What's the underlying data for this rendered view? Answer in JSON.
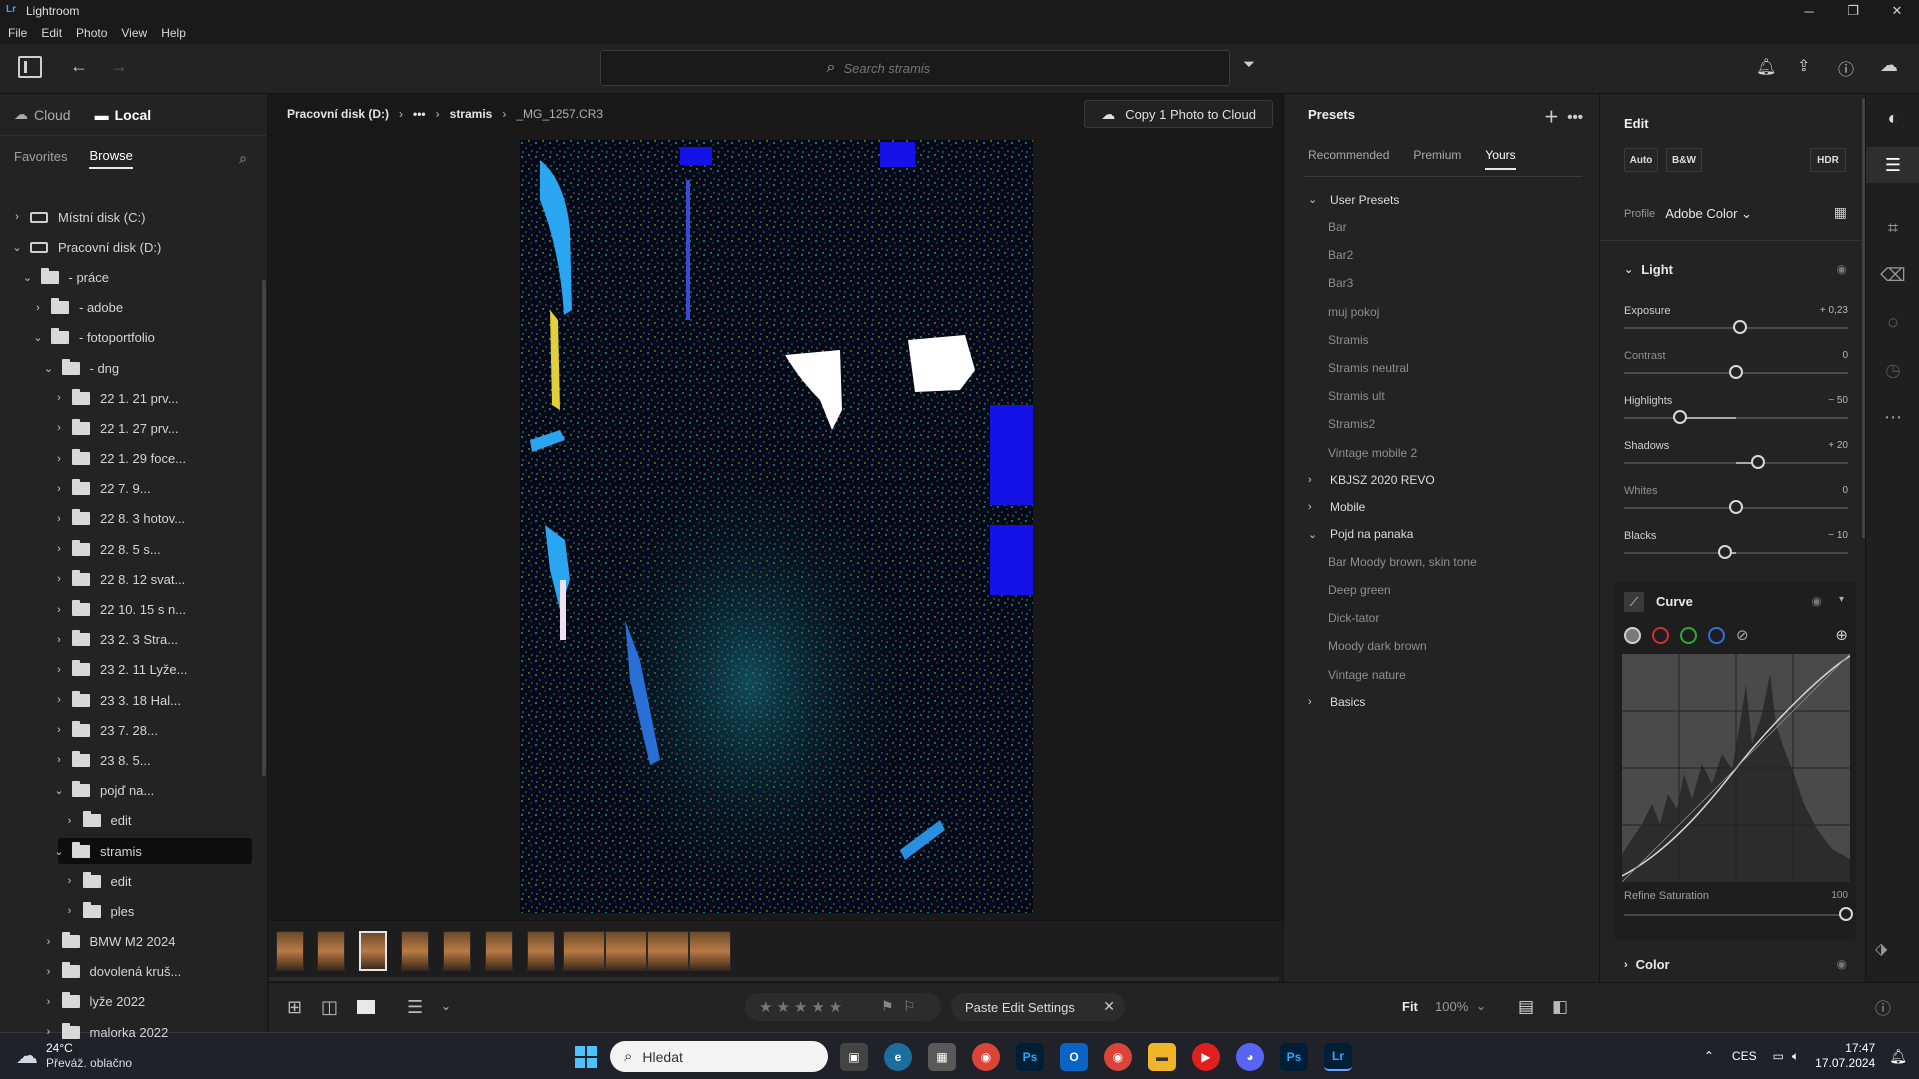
{
  "window": {
    "title": "Lightroom",
    "logo": "Lr"
  },
  "menu": [
    "File",
    "Edit",
    "Photo",
    "View",
    "Help"
  ],
  "search": {
    "placeholder": "Search stramis"
  },
  "source_tabs": {
    "cloud": "Cloud",
    "local": "Local"
  },
  "browse_tabs": {
    "favorites": "Favorites",
    "browse": "Browse"
  },
  "tree": [
    {
      "label": "Místní disk (C:)",
      "depth": 0,
      "type": "drive",
      "chev": "right"
    },
    {
      "label": "Pracovní disk (D:)",
      "depth": 0,
      "type": "drive",
      "chev": "down"
    },
    {
      "label": "- práce",
      "depth": 1,
      "type": "folder",
      "chev": "down"
    },
    {
      "label": "- adobe",
      "depth": 2,
      "type": "folder",
      "chev": "right"
    },
    {
      "label": "- fotoportfolio",
      "depth": 2,
      "type": "folder",
      "chev": "down"
    },
    {
      "label": "- dng",
      "depth": 3,
      "type": "folder",
      "chev": "down"
    },
    {
      "label": "22 1. 21 prv...",
      "depth": 4,
      "type": "folder",
      "chev": "right"
    },
    {
      "label": "22 1. 27 prv...",
      "depth": 4,
      "type": "folder",
      "chev": "right"
    },
    {
      "label": "22 1. 29 foce...",
      "depth": 4,
      "type": "folder",
      "chev": "right"
    },
    {
      "label": "22 7. 9...",
      "depth": 4,
      "type": "folder",
      "chev": "right"
    },
    {
      "label": "22 8. 3 hotov...",
      "depth": 4,
      "type": "folder",
      "chev": "right"
    },
    {
      "label": "22 8. 5 s...",
      "depth": 4,
      "type": "folder",
      "chev": "right"
    },
    {
      "label": "22 8. 12 svat...",
      "depth": 4,
      "type": "folder",
      "chev": "right"
    },
    {
      "label": "22 10. 15 s n...",
      "depth": 4,
      "type": "folder",
      "chev": "right"
    },
    {
      "label": "23 2. 3 Stra...",
      "depth": 4,
      "type": "folder",
      "chev": "right"
    },
    {
      "label": "23 2. 11 Lyže...",
      "depth": 4,
      "type": "folder",
      "chev": "right"
    },
    {
      "label": "23 3. 18 Hal...",
      "depth": 4,
      "type": "folder",
      "chev": "right"
    },
    {
      "label": "23 7. 28...",
      "depth": 4,
      "type": "folder",
      "chev": "right"
    },
    {
      "label": "23 8. 5...",
      "depth": 4,
      "type": "folder",
      "chev": "right"
    },
    {
      "label": "pojď na...",
      "depth": 4,
      "type": "folder",
      "chev": "down"
    },
    {
      "label": "edit",
      "depth": 5,
      "type": "folder",
      "chev": "right"
    },
    {
      "label": "stramis",
      "depth": 4,
      "type": "folder",
      "chev": "down",
      "selected": true
    },
    {
      "label": "edit",
      "depth": 5,
      "type": "folder",
      "chev": "right"
    },
    {
      "label": "ples",
      "depth": 5,
      "type": "folder",
      "chev": "right"
    },
    {
      "label": "BMW M2 2024",
      "depth": 3,
      "type": "folder",
      "chev": "right"
    },
    {
      "label": "dovolená kruš...",
      "depth": 3,
      "type": "folder",
      "chev": "right"
    },
    {
      "label": "lyže 2022",
      "depth": 3,
      "type": "folder",
      "chev": "right"
    },
    {
      "label": "malorka 2022",
      "depth": 3,
      "type": "folder",
      "chev": "right"
    }
  ],
  "breadcrumb": {
    "drive": "Pracovní disk (D:)",
    "ellipsis": "•••",
    "folder": "stramis",
    "file": "_MG_1257.CR3"
  },
  "copy_button": "Copy 1 Photo to Cloud",
  "presets": {
    "title": "Presets",
    "tabs": [
      "Recommended",
      "Premium",
      "Yours"
    ],
    "active_tab": "Yours",
    "groups": [
      {
        "name": "User Presets",
        "open": true,
        "items": [
          "Bar",
          "Bar2",
          "Bar3",
          "muj pokoj",
          "Stramis",
          "Stramis neutral",
          "Stramis ult",
          "Stramis2",
          "Vintage mobile 2"
        ]
      },
      {
        "name": "KBJSZ 2020 REVO",
        "open": false,
        "items": []
      },
      {
        "name": "Mobile",
        "open": false,
        "items": []
      },
      {
        "name": "Pojd na panaka",
        "open": true,
        "items": [
          "Bar Moody brown, skin tone",
          "Deep green",
          "Dick-tator",
          "Moody dark brown",
          "Vintage nature"
        ]
      },
      {
        "name": "Basics",
        "open": false,
        "items": []
      }
    ]
  },
  "edit": {
    "title": "Edit",
    "buttons": {
      "auto": "Auto",
      "bw": "B&W",
      "hdr": "HDR"
    },
    "profile_label": "Profile",
    "profile_value": "Adobe Color",
    "light": {
      "title": "Light",
      "sliders": [
        {
          "label": "Exposure",
          "value": "+ 0,23",
          "pos": 0.52,
          "bright": true
        },
        {
          "label": "Contrast",
          "value": "0",
          "pos": 0.5,
          "bright": false
        },
        {
          "label": "Highlights",
          "value": "− 50",
          "pos": 0.25,
          "bright": true
        },
        {
          "label": "Shadows",
          "value": "+ 20",
          "pos": 0.6,
          "bright": true
        },
        {
          "label": "Whites",
          "value": "0",
          "pos": 0.5,
          "bright": false
        },
        {
          "label": "Blacks",
          "value": "− 10",
          "pos": 0.45,
          "bright": true
        }
      ]
    },
    "curve": {
      "title": "Curve",
      "refine_label": "Refine Saturation",
      "refine_value": "100",
      "refine_pos": 1.0
    },
    "color": {
      "title": "Color"
    }
  },
  "bottombar": {
    "paste": "Paste Edit Settings",
    "fit": "Fit",
    "zoom": "100%"
  },
  "taskbar": {
    "weather_temp": "24°C",
    "weather_desc": "Převáž. oblačno",
    "search": "Hledat",
    "lang": "CES",
    "time": "17:47",
    "date": "17.07.2024"
  }
}
